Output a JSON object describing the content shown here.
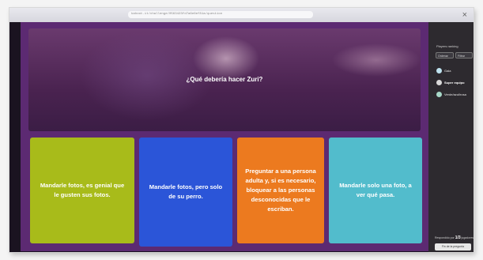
{
  "browser": {
    "address": "kahoot.it/challenge/0563423fd7a6e6ef81a/question",
    "close_glyph": "×"
  },
  "question": {
    "text": "¿Qué debería hacer Zuri?"
  },
  "answers": [
    {
      "text": "Mandarle fotos, es genial que le gusten sus fotos.",
      "color": "#a8bb1a"
    },
    {
      "text": "Mandarle fotos, pero solo de su perro.",
      "color": "#2b55d8"
    },
    {
      "text": "Preguntar a una persona adulta y, si es necesario, bloquear a las personas desconocidas que le escriban.",
      "color": "#ec7a1f"
    },
    {
      "text": "Mandarle solo una foto, a ver qué pasa.",
      "color": "#52bccc"
    }
  ],
  "side": {
    "title": "Players ranking",
    "chips": [
      "Ordenar",
      "Filtrar"
    ],
    "players": [
      "Gala",
      "Super equipo",
      "Verde/azul/rosa"
    ],
    "answered_label": "Respondido por",
    "answered_count": "1/3",
    "answered_suffix": "jugadores",
    "end_button": "Fin de la pregunta"
  }
}
